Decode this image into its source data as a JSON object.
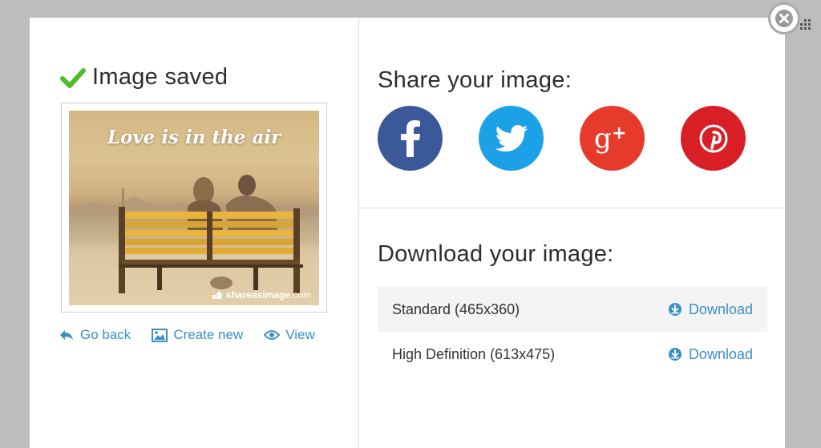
{
  "saved": {
    "title": "Image saved",
    "check_icon": "check-icon",
    "check_color": "#4dbb2a"
  },
  "preview": {
    "caption": "Love is in the air",
    "watermark_brand": "shareasimage",
    "watermark_suffix": ".com"
  },
  "links": [
    {
      "label": "Go back",
      "icon": "back-arrow-icon"
    },
    {
      "label": "Create new",
      "icon": "image-icon"
    },
    {
      "label": "View",
      "icon": "eye-icon"
    }
  ],
  "share": {
    "title": "Share your image:",
    "networks": [
      {
        "name": "facebook",
        "glyph": "f",
        "color": "#3b5998"
      },
      {
        "name": "twitter",
        "glyph": "bird",
        "color": "#1da1e6"
      },
      {
        "name": "google-plus",
        "glyph": "g+",
        "color": "#e63b2c"
      },
      {
        "name": "pinterest",
        "glyph": "p",
        "color": "#d81f26"
      }
    ]
  },
  "download": {
    "title": "Download your image:",
    "rows": [
      {
        "label": "Standard (465x360)",
        "action": "Download"
      },
      {
        "label": "High Definition (613x475)",
        "action": "Download"
      }
    ]
  },
  "accent_color": "#3a8fc5"
}
